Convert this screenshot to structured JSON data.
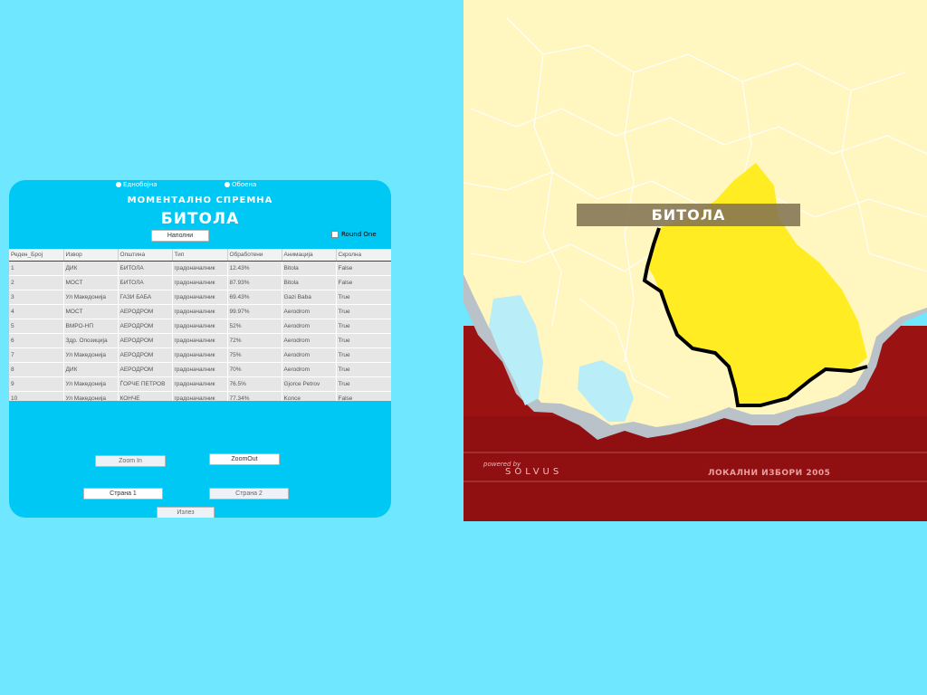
{
  "radio": {
    "option1": "Еднобојна",
    "option2": "Обоена"
  },
  "panel": {
    "subtitle": "МОМЕНТАЛНО СПРЕМНА",
    "city": "БИТОЛА",
    "fill_button": "Наполни",
    "round_one_label": "Round One"
  },
  "table": {
    "headers": [
      "Реден_Број",
      "Извор",
      "Општина",
      "Тип",
      "Обработени",
      "Анимација",
      "Скролна"
    ],
    "rows": [
      [
        "1",
        "ДИК",
        "БИТОЛА",
        "градоначалник",
        "12.43%",
        "Bitola",
        "False"
      ],
      [
        "2",
        "МОСТ",
        "БИТОЛА",
        "градоначалник",
        "87.93%",
        "Bitola",
        "False"
      ],
      [
        "3",
        "Ул Македонија",
        "ГАЗИ БАБА",
        "градоначалник",
        "69.43%",
        "Gazi Baba",
        "True"
      ],
      [
        "4",
        "МОСТ",
        "АЕРОДРОМ",
        "градоначалник",
        "99.97%",
        "Aerodrom",
        "True"
      ],
      [
        "5",
        "ВМРО-НП",
        "АЕРОДРОМ",
        "градоначалник",
        "52%",
        "Aerodrom",
        "True"
      ],
      [
        "6",
        "Здр. Опозиција",
        "АЕРОДРОМ",
        "градоначалник",
        "72%",
        "Aerodrom",
        "True"
      ],
      [
        "7",
        "Ул Македонија",
        "АЕРОДРОМ",
        "градоначалник",
        "75%",
        "Aerodrom",
        "True"
      ],
      [
        "8",
        "ДИК",
        "АЕРОДРОМ",
        "градоначалник",
        "70%",
        "Aerodrom",
        "True"
      ],
      [
        "9",
        "Ул Македонија",
        "ЃОРЧЕ ПЕТРОВ",
        "градоначалник",
        "76.5%",
        "Gjorce Petrov",
        "True"
      ],
      [
        "10",
        "Ул Македонија",
        "КОНЧЕ",
        "градоначалник",
        "77.34%",
        "Konce",
        "False"
      ]
    ]
  },
  "buttons": {
    "zoom_in": "Zoom In",
    "zoom_out": "ZoomOut",
    "page1": "Страна 1",
    "page2": "Страна 2",
    "exit": "Излез"
  },
  "map": {
    "label": "БИТОЛА",
    "powered_by": "powered by",
    "brand": "SOLVUS",
    "elections": "ЛОКАЛНИ ИЗБОРИ 2005"
  },
  "colors": {
    "background": "#6fe8ff",
    "panel": "#00c8f5",
    "highlight_region": "#ffec22",
    "land": "#fff6c0",
    "lake": "#b9edf7",
    "footer": "#9a1212"
  }
}
